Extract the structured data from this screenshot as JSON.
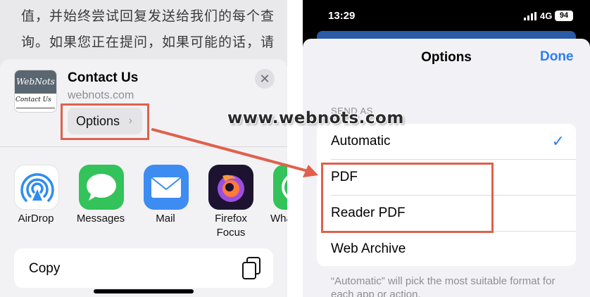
{
  "left_screen": {
    "background_text": [
      "值，并始终尝试回复发送给我们的每个查",
      "询。如果您正在提问，如果可能的话，请"
    ],
    "share_sheet": {
      "thumbnail": {
        "logo_text": "WebNots",
        "page_text": "Contact Us"
      },
      "title": "Contact Us",
      "domain": "webnots.com",
      "options_label": "Options",
      "options_chevron": "›",
      "close_glyph": "✕",
      "apps": [
        {
          "label": "AirDrop",
          "icon": "airdrop-icon"
        },
        {
          "label": "Messages",
          "icon": "messages-icon"
        },
        {
          "label": "Mail",
          "icon": "mail-icon"
        },
        {
          "label": "Firefox",
          "label2": "Focus",
          "icon": "firefox-focus-icon"
        },
        {
          "label": "Wha",
          "icon": "whatsapp-icon"
        }
      ],
      "copy_label": "Copy"
    }
  },
  "right_screen": {
    "status_bar": {
      "time": "13:29",
      "network": "4G",
      "battery": "94"
    },
    "options_sheet": {
      "title": "Options",
      "done_label": "Done",
      "section_header": "SEND AS",
      "rows": [
        {
          "label": "Automatic",
          "selected": true
        },
        {
          "label": "PDF",
          "selected": false
        },
        {
          "label": "Reader PDF",
          "selected": false
        },
        {
          "label": "Web Archive",
          "selected": false
        }
      ],
      "check_glyph": "✓",
      "footnote": "“Automatic” will pick the most suitable format for each app or action."
    }
  },
  "watermark": "www.webnots.com",
  "colors": {
    "highlight": "#e0604c",
    "ios_blue": "#2d7cf6"
  }
}
